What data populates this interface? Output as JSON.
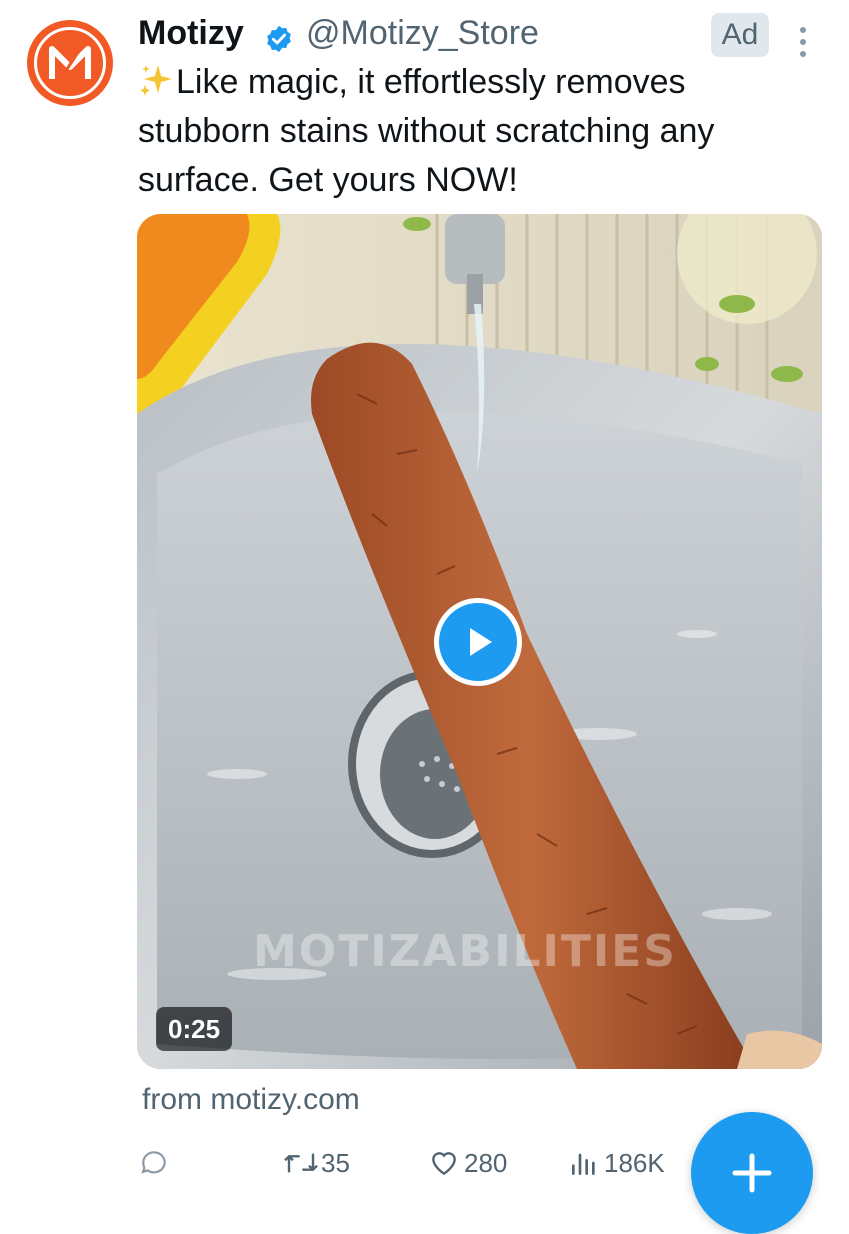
{
  "author": {
    "name": "Motizy",
    "handle": "@Motizy_Store",
    "avatar_letter": "M",
    "verified": true
  },
  "ad_label": "Ad",
  "tweet": {
    "emoji": "sparkles",
    "text": "Like magic, it effortlessly removes stubborn stains without scratching any surface. Get yours NOW!"
  },
  "media": {
    "duration": "0:25",
    "watermark": "MOTIZABILITIES"
  },
  "source_text": "from motizy.com",
  "actions": {
    "reply_count": "",
    "retweet_count": "35",
    "like_count": "280",
    "view_count": "186K"
  },
  "colors": {
    "accent": "#1d9bf0",
    "brand": "#f15a24",
    "muted_text": "#536471"
  },
  "icons": [
    "verified-badge-icon",
    "more-options-icon",
    "sparkles-icon",
    "play-icon",
    "reply-icon",
    "retweet-icon",
    "like-icon",
    "views-icon",
    "compose-plus-icon"
  ]
}
